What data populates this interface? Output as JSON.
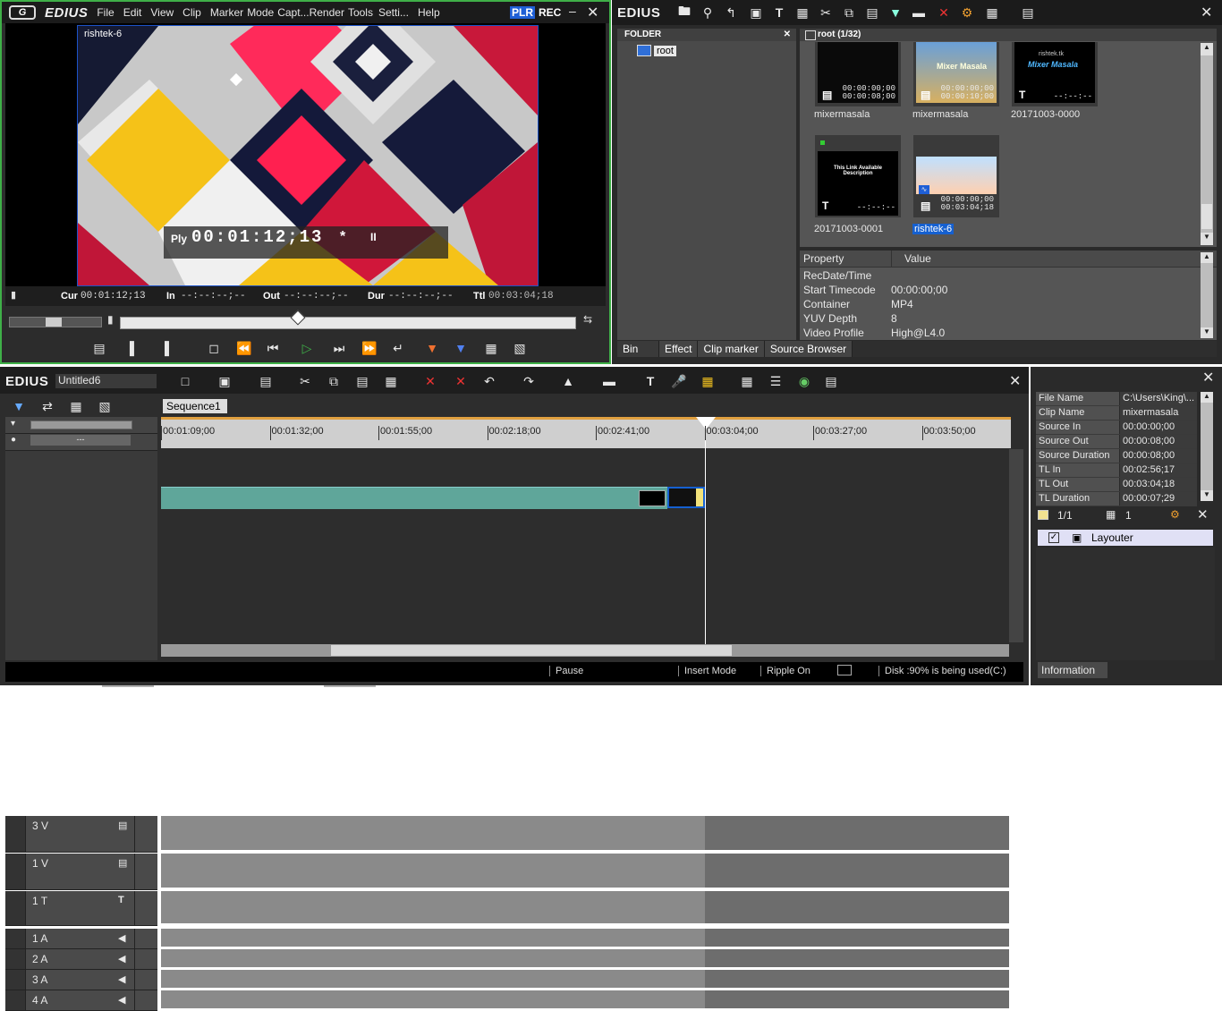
{
  "player": {
    "title": "EDIUS",
    "menu": [
      "File",
      "Edit",
      "View",
      "Clip",
      "Marker",
      "Mode",
      "Capt...",
      "Render",
      "Tools",
      "Setti...",
      "Help"
    ],
    "plr": "PLR",
    "rec": "REC",
    "clip_label": "rishtek-6",
    "overlay_prefix": "Ply",
    "overlay_tc": "00:01:12;13",
    "overlay_star": "*",
    "cur_label": "Cur",
    "cur_value": "00:01:12;13",
    "in_label": "In",
    "in_value": "--:--:--;--",
    "out_label": "Out",
    "out_value": "--:--:--;--",
    "dur_label": "Dur",
    "dur_value": "--:--:--;--",
    "ttl_label": "Ttl",
    "ttl_value": "00:03:04;18",
    "scrub_position": 0.39
  },
  "bin": {
    "title": "EDIUS",
    "folder_header": "FOLDER",
    "folder_root": "root",
    "clips_header": "root (1/32)",
    "clips": [
      {
        "name": "mixermasala",
        "tc_in": "00:00:00;00",
        "tc_out": "00:00:08;00",
        "type": "video"
      },
      {
        "name": "mixermasala",
        "tc_in": "00:00:00;00",
        "tc_out": "00:00:10;00",
        "type": "video"
      },
      {
        "name": "20171003-0000",
        "tc_in": "",
        "tc_out": "--:--:--",
        "type": "title"
      },
      {
        "name": "20171003-0001",
        "tc_in": "",
        "tc_out": "--:--:--",
        "type": "title"
      },
      {
        "name": "rishtek-6",
        "tc_in": "00:00:00;00",
        "tc_out": "00:03:04;18",
        "type": "video"
      }
    ],
    "thumb_text_1": "Mixer Masala",
    "thumb_text_2": "rishtek.tk",
    "thumb_text_3": "This Link Available Description",
    "prop_header": "Property",
    "value_header": "Value",
    "properties": [
      {
        "k": "RecDate/Time",
        "v": ""
      },
      {
        "k": "Start Timecode",
        "v": "00:00:00;00"
      },
      {
        "k": "Container",
        "v": "MP4"
      },
      {
        "k": "YUV Depth",
        "v": "8"
      },
      {
        "k": "Video Profile",
        "v": "High@L4.0"
      }
    ],
    "tabs": [
      "Bin",
      "Effect",
      "Clip marker",
      "Source Browser"
    ]
  },
  "timeline": {
    "title": "EDIUS",
    "project": "Untitled6",
    "sequence_tab": "Sequence1",
    "ruler": [
      "00:01:09;00",
      "00:01:32;00",
      "00:01:55;00",
      "00:02:18;00",
      "00:02:41;00",
      "00:03:04;00",
      "00:03:27;00",
      "00:03:50;00"
    ],
    "ruler_separator": "---",
    "tracks": [
      "3 V",
      "1 V",
      "1 T",
      "1 A",
      "2 A",
      "3 A",
      "4 A"
    ],
    "status": [
      "Pause",
      "Insert Mode",
      "Ripple On",
      "Disk :90% is being used(C:)"
    ]
  },
  "info": {
    "rows": [
      {
        "k": "File Name",
        "v": "C:\\Users\\King\\..."
      },
      {
        "k": "Clip Name",
        "v": "mixermasala"
      },
      {
        "k": "Source In",
        "v": "00:00:00;00"
      },
      {
        "k": "Source Out",
        "v": "00:00:08;00"
      },
      {
        "k": "Source Duration",
        "v": "00:00:08;00"
      },
      {
        "k": "TL In",
        "v": "00:02:56;17"
      },
      {
        "k": "TL Out",
        "v": "00:03:04;18"
      },
      {
        "k": "TL Duration",
        "v": "00:00:07;29"
      }
    ],
    "page": "1/1",
    "count": "1",
    "layouter": "Layouter",
    "tab": "Information"
  },
  "colors": {
    "accent_green": "#3fb048",
    "clip_teal": "#5fa69a",
    "selection_blue": "#1560d0"
  }
}
